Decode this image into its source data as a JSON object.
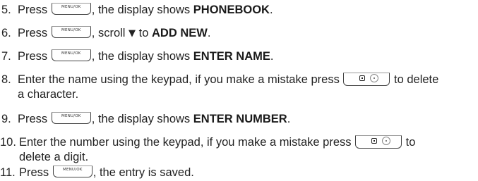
{
  "key_labels": {
    "menu_ok": "MENU/OK"
  },
  "icons": {
    "menu_ok_key": "menu-ok-key-icon",
    "delete_key": "delete-key-icon",
    "scroll_down": "triangle-down-icon"
  },
  "steps": [
    {
      "number": "5.",
      "press": "Press",
      "after_key": ", the display shows ",
      "bold": "PHONEBOOK",
      "end": "."
    },
    {
      "number": "6.",
      "press": "Press",
      "after_key": ", scroll ",
      "arrow": "▼",
      "to": " to ",
      "bold": "ADD NEW",
      "end": "."
    },
    {
      "number": "7.",
      "press": "Press",
      "after_key": ", the display shows ",
      "bold": "ENTER NAME",
      "end": "."
    },
    {
      "number": "8.",
      "text_before": "Enter the name using the keypad, if you make a mistake press ",
      "text_after": " to delete",
      "text_line2": "a character."
    },
    {
      "number": "9.",
      "press": "Press",
      "after_key": ", the display shows ",
      "bold": "ENTER NUMBER",
      "end": "."
    },
    {
      "number": "10.",
      "text_before": "Enter the number using the keypad, if you make a mistake press ",
      "text_after": " to",
      "text_line2": "delete a digit."
    },
    {
      "number": "11.",
      "press": "Press",
      "after_key": ", the entry is saved."
    }
  ]
}
